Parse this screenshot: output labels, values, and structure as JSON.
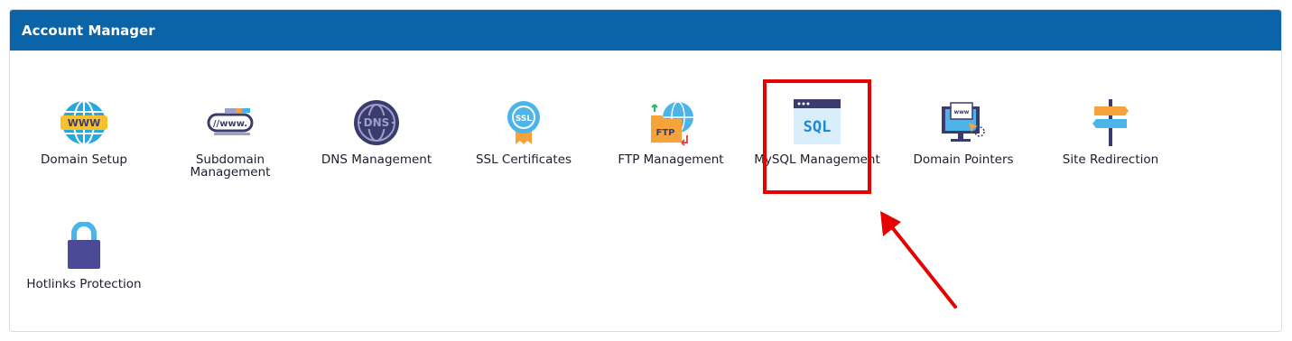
{
  "panel": {
    "title": "Account Manager",
    "items": [
      {
        "label": "Domain Setup",
        "icon": "globe-www-icon"
      },
      {
        "label": "Subdomain Management",
        "icon": "subdomain-www-icon"
      },
      {
        "label": "DNS Management",
        "icon": "dns-globe-icon"
      },
      {
        "label": "SSL Certificates",
        "icon": "ssl-badge-icon"
      },
      {
        "label": "FTP Management",
        "icon": "ftp-folder-icon"
      },
      {
        "label": "MySQL Management",
        "icon": "sql-window-icon"
      },
      {
        "label": "Domain Pointers",
        "icon": "monitor-www-icon"
      },
      {
        "label": "Site Redirection",
        "icon": "signpost-icon"
      },
      {
        "label": "Hotlinks Protection",
        "icon": "padlock-icon"
      }
    ]
  },
  "annotation": {
    "highlight_color": "#e60000",
    "target": "MySQL Management"
  },
  "colors": {
    "header": "#0c64a8",
    "text": "#1a1f2e"
  }
}
